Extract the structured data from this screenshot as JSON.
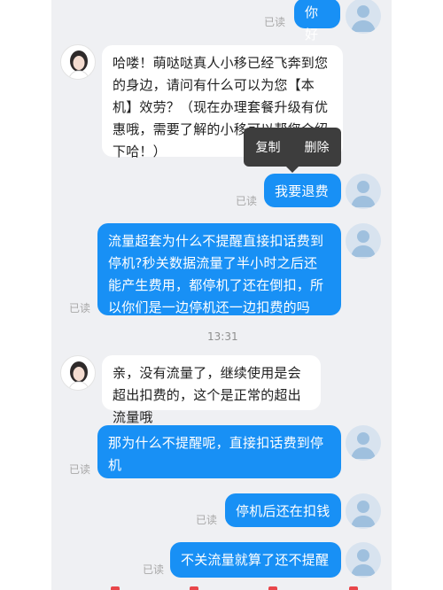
{
  "chat": {
    "read_label": "已读",
    "timestamp": "13:31",
    "messages": [
      {
        "text": "你好"
      },
      {
        "text": "哈喽！萌哒哒真人小移已经飞奔到您的身边，请问有什么可以为您【本机】效劳？（现在办理套餐升级有优惠哦，需要了解的小移可以帮您介绍下哈！）"
      },
      {
        "text": "我要退费"
      },
      {
        "text": "流量超套为什么不提醒直接扣话费到停机?秒关数据流量了半小时之后还能产生费用，都停机了还在倒扣，所以你们是一边停机还一边扣费的吗"
      },
      {
        "text": "亲，没有流量了，继续使用是会超出扣费的，这个是正常的超出流量哦"
      },
      {
        "text": "那为什么不提醒呢，直接扣话费到停机"
      },
      {
        "text": "停机后还在扣钱"
      },
      {
        "text": "不关流量就算了还不提醒"
      }
    ]
  },
  "context_menu": {
    "copy": "复制",
    "delete": "删除"
  },
  "icons": {
    "user_avatar": "person-icon",
    "agent_avatar": "agent-avatar-icon"
  },
  "colors": {
    "bubble_out": "#1890f5",
    "background": "#eff0f3"
  }
}
